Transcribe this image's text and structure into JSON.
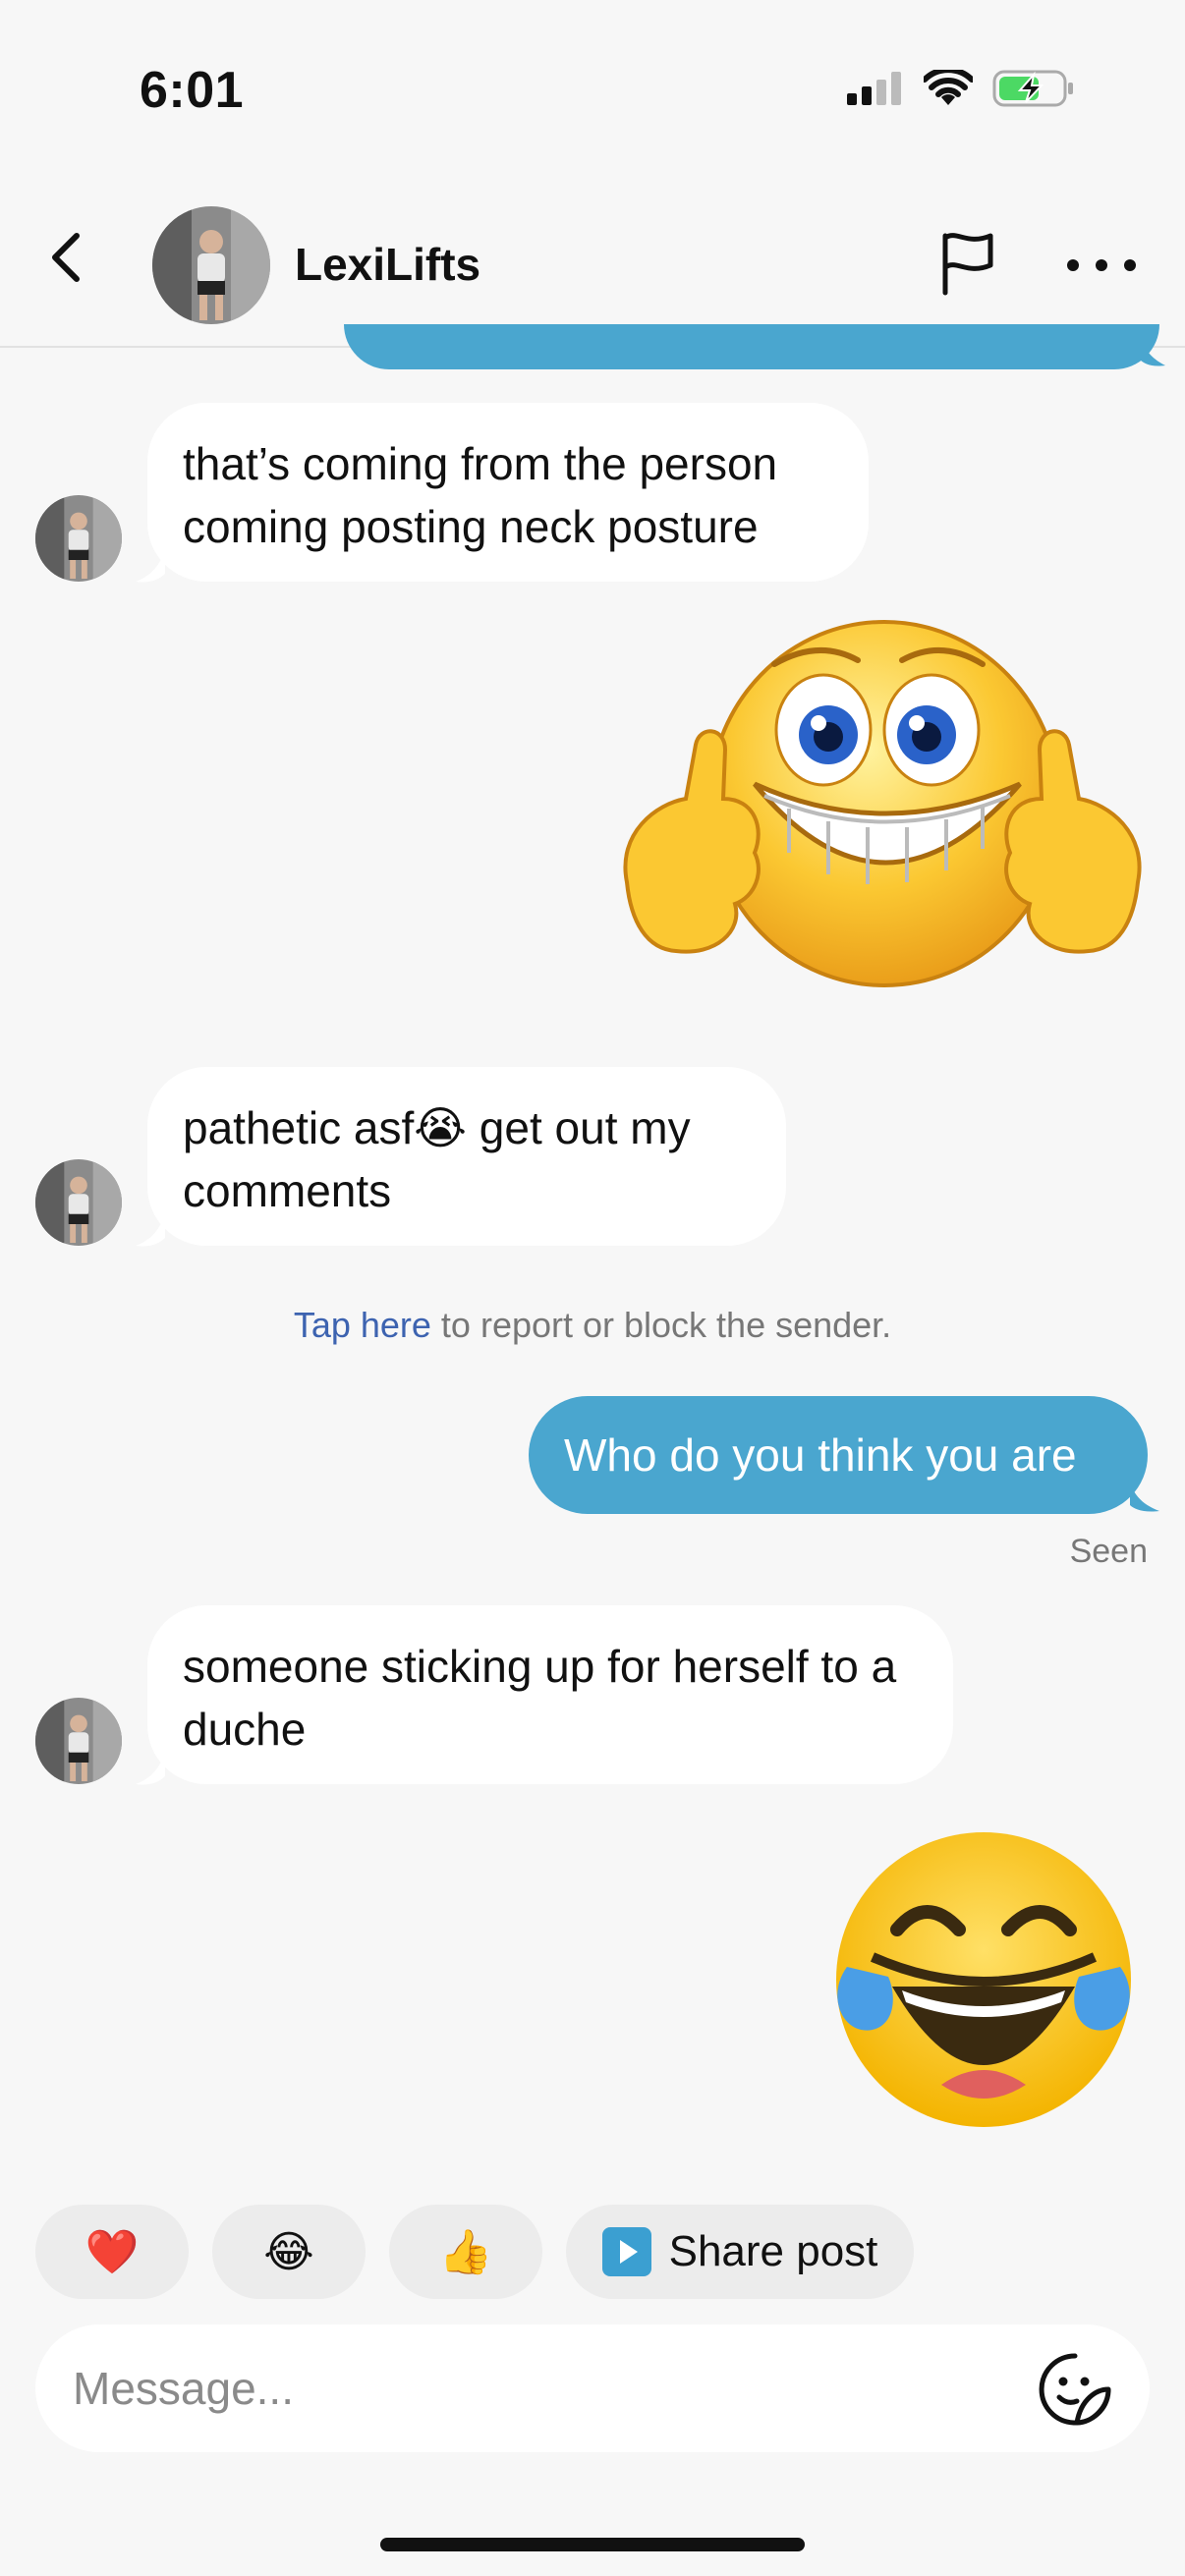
{
  "status_bar": {
    "time": "6:01"
  },
  "header": {
    "name": "LexiLifts"
  },
  "messages": [
    {
      "from": "them",
      "text": "that’s coming from the person coming posting neck posture"
    },
    {
      "from": "me",
      "sticker": "thumbs-up-grin-emoji"
    },
    {
      "from": "them",
      "text_before": "pathetic asf",
      "emoji": "😭",
      "text_after": " get out my comments"
    },
    {
      "from": "me",
      "text": "Who do you think you are"
    },
    {
      "from": "them",
      "text": "someone sticking up for herself to a duche"
    },
    {
      "from": "me",
      "sticker": "tears-of-joy-emoji"
    }
  ],
  "system_note": {
    "link": "Tap here",
    "text": " to report or block the sender."
  },
  "seen_label": "Seen",
  "quick_reactions": [
    {
      "emoji": "❤️"
    },
    {
      "emoji": "😂"
    },
    {
      "emoji": "👍"
    },
    {
      "label": "Share post"
    }
  ],
  "composer": {
    "placeholder": "Message..."
  },
  "colors": {
    "outgoing_bubble": "#4aa6cf",
    "link": "#3d63b0",
    "background": "#f7f7f7"
  }
}
